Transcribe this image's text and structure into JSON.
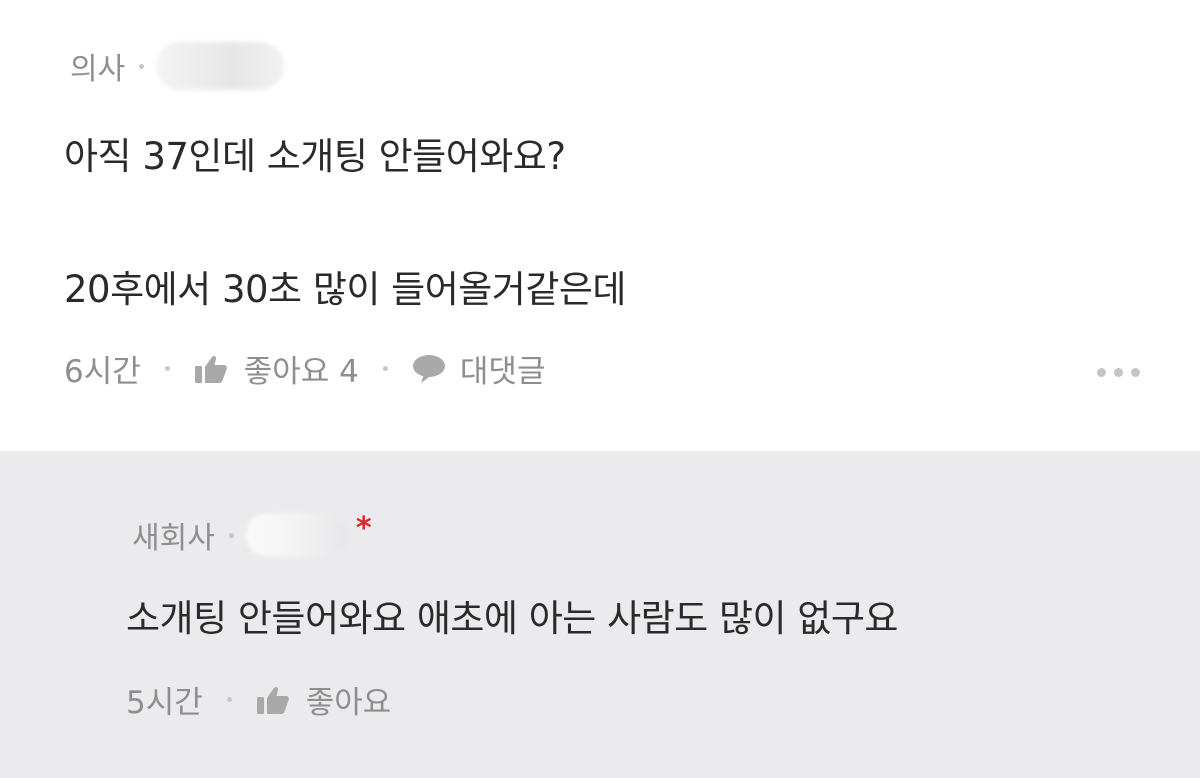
{
  "comment": {
    "author_job": "의사",
    "text_line1": "아직 37인데 소개팅 안들어와요?",
    "text_line2": "20후에서 30초 많이 들어올거같은데",
    "time": "6시간",
    "like_label": "좋아요 4",
    "reply_label": "대댓글"
  },
  "reply": {
    "author_job": "새회사",
    "badge": "*",
    "text": "소개팅 안들어와요 애초에 아는 사람도 많이 없구요",
    "time": "5시간",
    "like_label": "좋아요"
  },
  "colors": {
    "reply_background": "#ebebed",
    "badge": "#e4262b",
    "meta_text": "#8e8e8e",
    "body_text": "#2a2a2a"
  },
  "icons": {
    "like": "thumbs-up-icon",
    "reply": "speech-bubble-icon",
    "more": "more-dots-icon"
  }
}
